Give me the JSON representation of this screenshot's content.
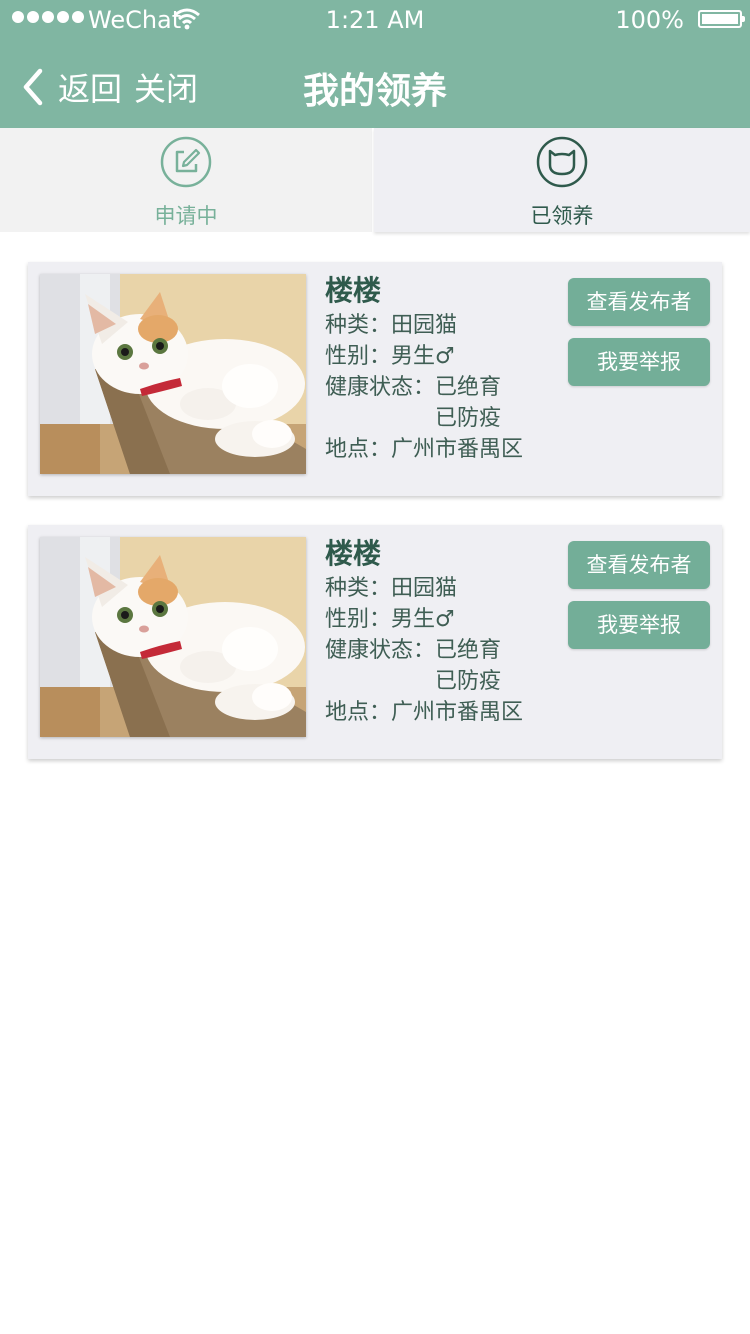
{
  "status_bar": {
    "carrier": "WeChat",
    "time": "1:21 AM",
    "battery": "100%"
  },
  "nav": {
    "back_label": "返回",
    "close_label": "关闭",
    "title": "我的领养"
  },
  "tabs": [
    {
      "label": "申请中",
      "icon": "edit-icon",
      "selected": false
    },
    {
      "label": "已领养",
      "icon": "cat-face-icon",
      "selected": true
    }
  ],
  "colors": {
    "header": "#80b6a2",
    "button": "#73ae98",
    "card": "#efeff3",
    "text": "#3f5e54"
  },
  "labels": {
    "breed": "种类：",
    "gender": "性别：",
    "health": "健康状态：",
    "location": "地点："
  },
  "pets": [
    {
      "name": "楼楼",
      "breed": "田园猫",
      "gender": "男生♂",
      "health": [
        "已绝育",
        "已防疫"
      ],
      "location": "广州市番禺区",
      "view_button": "查看发布者",
      "report_button": "我要举报"
    },
    {
      "name": "楼楼",
      "breed": "田园猫",
      "gender": "男生♂",
      "health": [
        "已绝育",
        "已防疫"
      ],
      "location": "广州市番禺区",
      "view_button": "查看发布者",
      "report_button": "我要举报"
    }
  ]
}
